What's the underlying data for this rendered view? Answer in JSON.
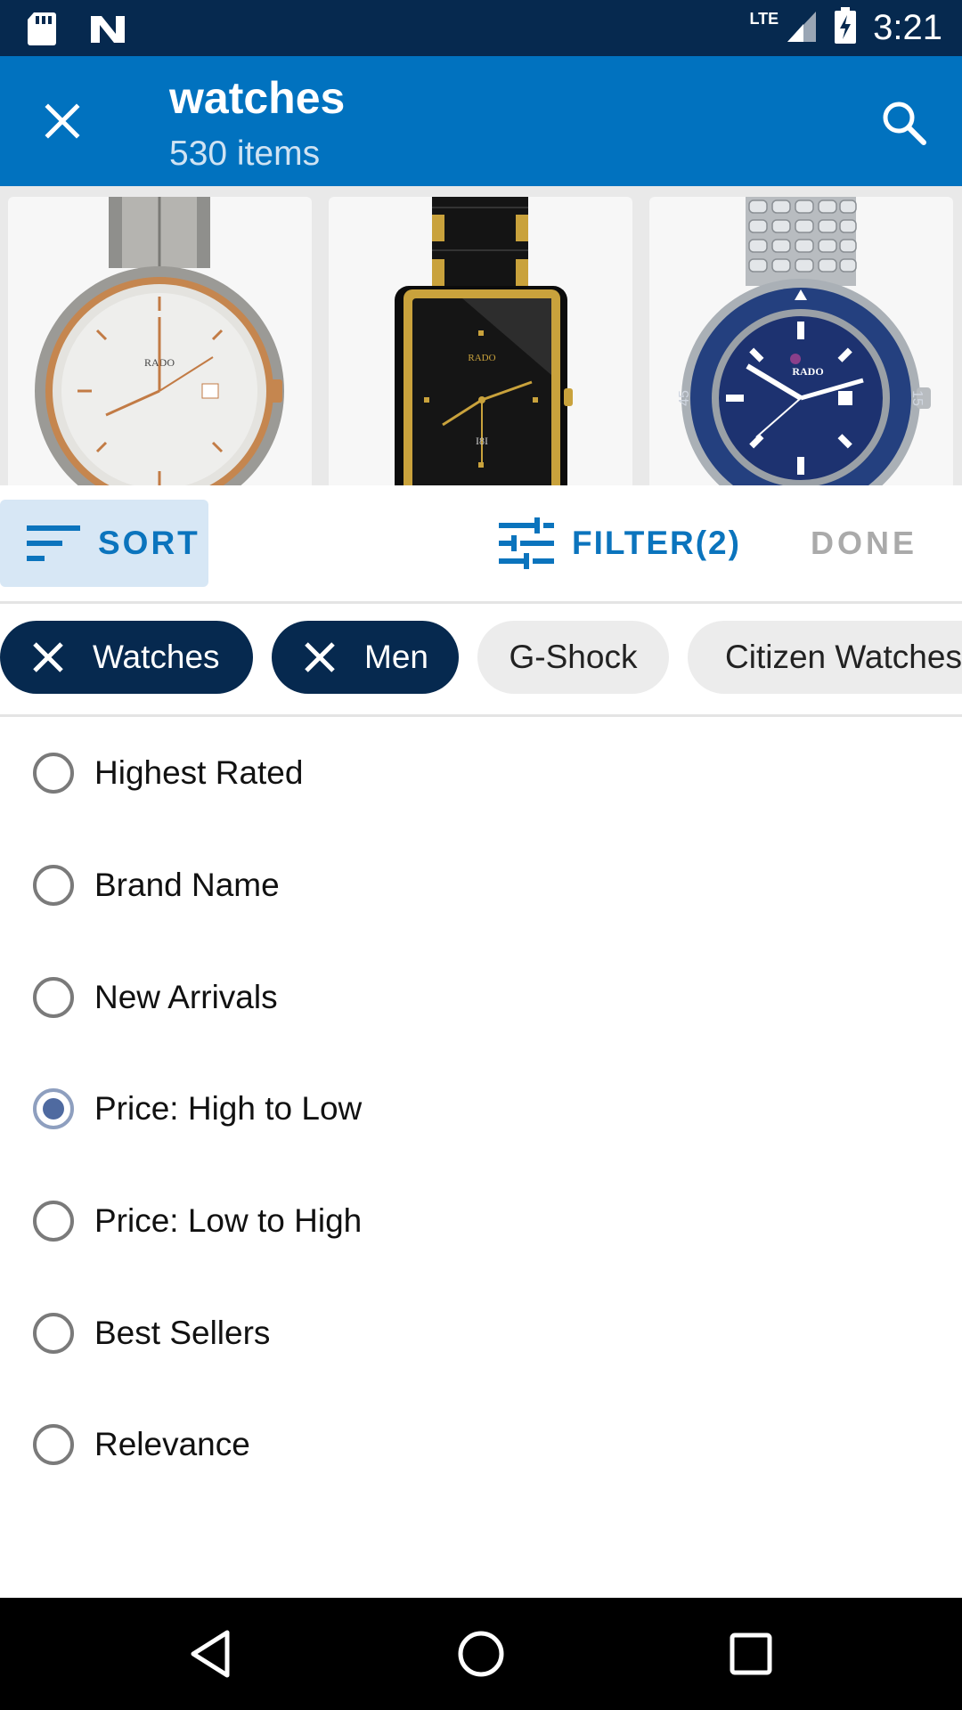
{
  "status_bar": {
    "time": "3:21",
    "network": "LTE",
    "icons": [
      "sd-card-icon",
      "n-logo-icon",
      "signal-icon",
      "battery-icon"
    ]
  },
  "app_bar": {
    "title": "watches",
    "subtitle": "530 items",
    "icons": [
      "close-icon",
      "search-icon"
    ]
  },
  "products": [
    {
      "brand": "RADO"
    },
    {
      "brand": "RADO"
    },
    {
      "brand": "RADO"
    }
  ],
  "action_bar": {
    "sort_label": "SORT",
    "filter_label": "FILTER(2)",
    "done_label": "DONE"
  },
  "chips": [
    {
      "label": "Watches",
      "active": true
    },
    {
      "label": "Men",
      "active": true
    },
    {
      "label": "G-Shock",
      "active": false
    },
    {
      "label": "Citizen Watches",
      "active": false
    }
  ],
  "sort_options": [
    {
      "label": "Highest Rated",
      "selected": false
    },
    {
      "label": "Brand Name",
      "selected": false
    },
    {
      "label": "New Arrivals",
      "selected": false
    },
    {
      "label": "Price: High to Low",
      "selected": true
    },
    {
      "label": "Price: Low to High",
      "selected": false
    },
    {
      "label": "Best Sellers",
      "selected": false
    },
    {
      "label": "Relevance",
      "selected": false
    }
  ],
  "colors": {
    "status_bar": "#06294f",
    "app_bar": "#0172bf",
    "accent": "#0b74bd",
    "chip_active": "#06294f"
  }
}
